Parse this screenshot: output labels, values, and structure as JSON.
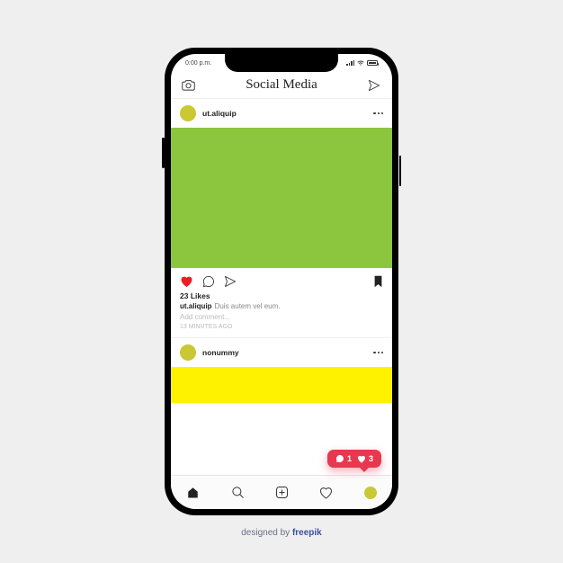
{
  "statusbar": {
    "time": "0:00 p.m."
  },
  "header": {
    "title": "Social Media"
  },
  "posts": [
    {
      "username": "ut.aliquip",
      "image_color": "#8cc63f",
      "likes_text": "23 Likes",
      "caption_user": "ut.aliquip",
      "caption_text": "Duis autem vel eum.",
      "add_comment_placeholder": "Add comment...",
      "timestamp": "13 MINUTES AGO"
    },
    {
      "username": "nonummy",
      "image_color": "#fff200"
    }
  ],
  "notification": {
    "comments": "1",
    "likes": "3"
  },
  "credit": {
    "prefix": "designed by ",
    "brand": "freepik"
  },
  "colors": {
    "accent_red": "#e8384f",
    "avatar": "#cac834",
    "heart_fill": "#ed1c24"
  }
}
